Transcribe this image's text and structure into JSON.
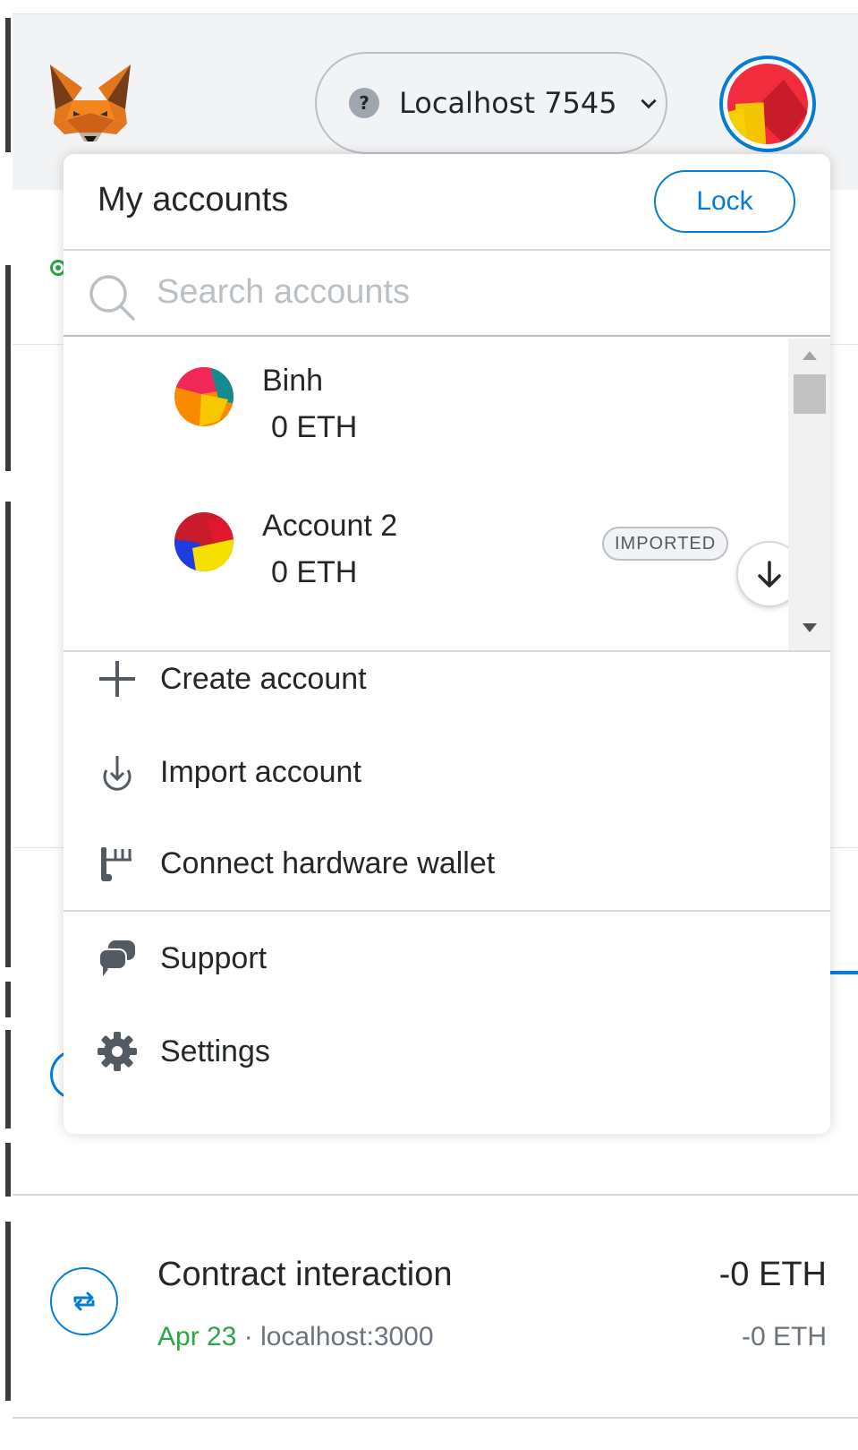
{
  "header": {
    "network_label": "Localhost 7545",
    "network_icon": "question-mark-icon"
  },
  "accounts_menu": {
    "title": "My accounts",
    "lock_label": "Lock",
    "search_placeholder": "Search accounts",
    "accounts": [
      {
        "name": "Binh",
        "balance": "0 ETH",
        "badge": ""
      },
      {
        "name": "Account 2",
        "balance": "0 ETH",
        "badge": "IMPORTED"
      }
    ],
    "actions": [
      {
        "label": "Create account",
        "icon": "plus-icon"
      },
      {
        "label": "Import account",
        "icon": "import-icon"
      },
      {
        "label": "Connect hardware wallet",
        "icon": "hardware-wallet-icon"
      }
    ],
    "secondary": [
      {
        "label": "Support",
        "icon": "chat-icon"
      },
      {
        "label": "Settings",
        "icon": "gear-icon"
      }
    ]
  },
  "activity": {
    "title": "Contract interaction",
    "date": "Apr 23",
    "separator": "·",
    "origin": "localhost:3000",
    "amount": "-0 ETH",
    "amount_secondary": "-0 ETH"
  },
  "colors": {
    "accent": "#037dd6",
    "success": "#28a745",
    "text": "#24272a",
    "muted": "#6a737d"
  }
}
